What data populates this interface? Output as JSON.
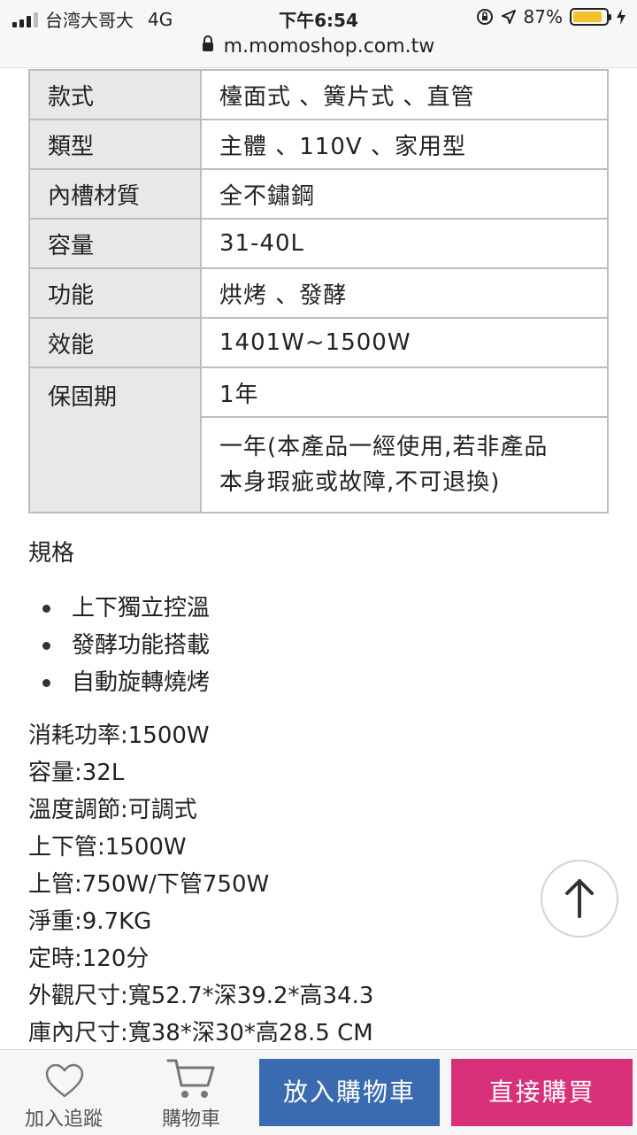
{
  "status_bar": {
    "carrier": "台湾大哥大",
    "network": "4G",
    "time": "下午6:54",
    "battery": "87%"
  },
  "url_bar": {
    "url": "m.momoshop.com.tw"
  },
  "spec_table": {
    "rows": [
      {
        "label": "款式",
        "value": "檯面式 、簧片式 、直管"
      },
      {
        "label": "類型",
        "value": "主體 、110V 、家用型"
      },
      {
        "label": "內槽材質",
        "value": "全不鏽鋼"
      },
      {
        "label": "容量",
        "value": "31-40L"
      },
      {
        "label": "功能",
        "value": "烘烤 、發酵"
      },
      {
        "label": "效能",
        "value": "1401W~1500W"
      },
      {
        "label": "保固期",
        "value": "1年"
      }
    ],
    "warranty_note_line1": "一年(本產品一經使用,若非產品",
    "warranty_note_line2": "本身瑕疵或故障,不可退換)"
  },
  "spec_section": {
    "title": "規格",
    "bullets": [
      "上下獨立控溫",
      "發酵功能搭載",
      "自動旋轉燒烤"
    ],
    "lines": [
      "消耗功率:1500W",
      "容量:32L",
      "溫度調節:可調式",
      "上下管:1500W",
      "上管:750W/下管750W",
      "淨重:9.7KG",
      "定時:120分",
      "外觀尺寸:寬52.7*深39.2*高34.3",
      "庫內尺寸:寬38*深30*高28.5 CM"
    ]
  },
  "bottom_bar": {
    "track_label": "加入追蹤",
    "cart_label": "購物車",
    "add_to_cart_label": "放入購物車",
    "buy_now_label": "直接購買"
  },
  "colors": {
    "add_to_cart": "#3a6bb0",
    "buy_now": "#d8317a",
    "battery": "#f4c22b"
  }
}
